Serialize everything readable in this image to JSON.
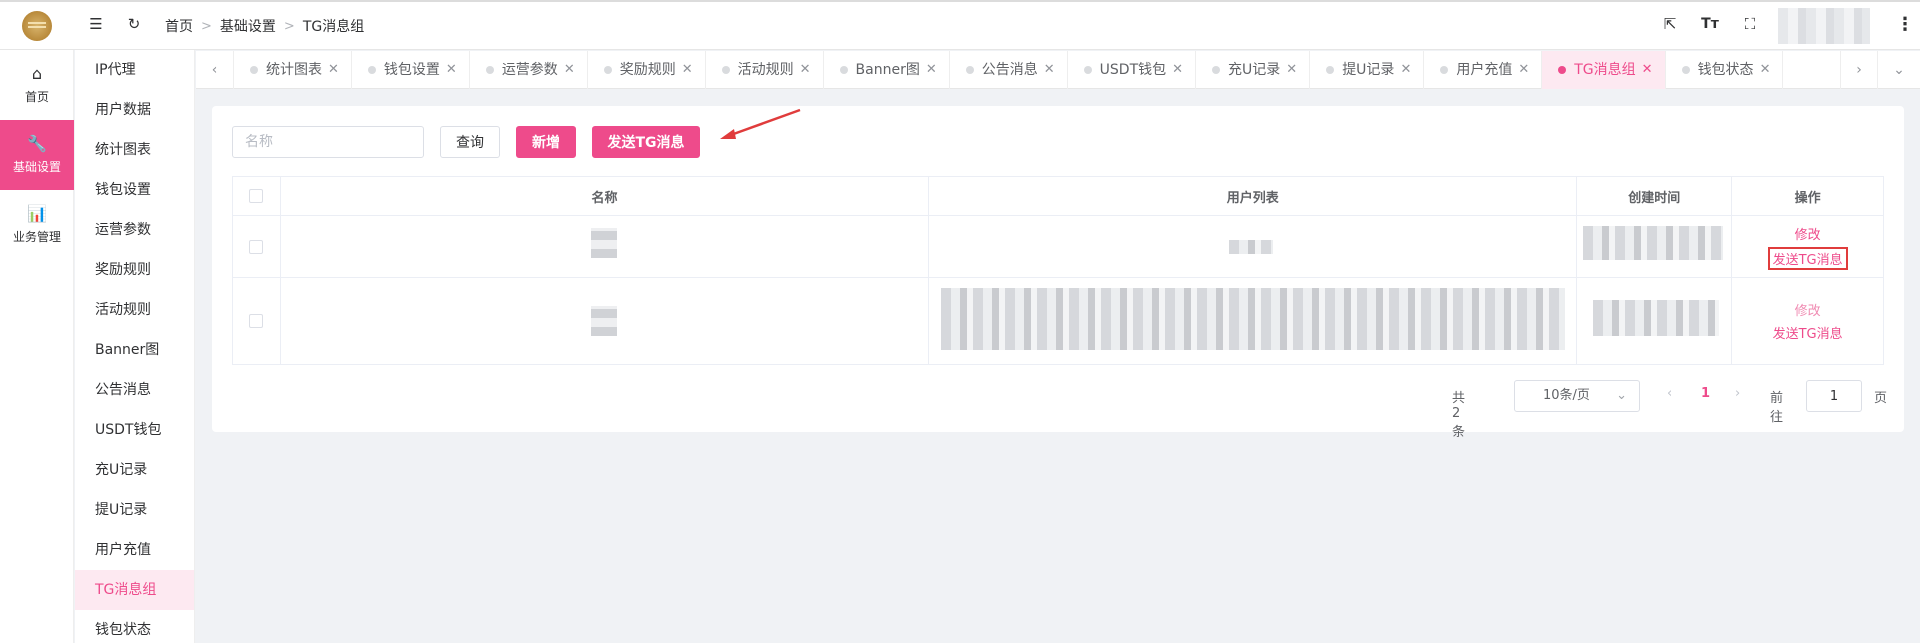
{
  "breadcrumb": [
    "首页",
    "基础设置",
    "TG消息组"
  ],
  "icon_rail": [
    {
      "label": "首页",
      "icon": "home-icon"
    },
    {
      "label": "基础设置",
      "icon": "wrench-icon",
      "active": true
    },
    {
      "label": "业务管理",
      "icon": "bar-chart-icon"
    }
  ],
  "submenu": [
    "IP代理",
    "用户数据",
    "统计图表",
    "钱包设置",
    "运营参数",
    "奖励规则",
    "活动规则",
    "Banner图",
    "公告消息",
    "USDT钱包",
    "充U记录",
    "提U记录",
    "用户充值",
    "TG消息组",
    "钱包状态"
  ],
  "submenu_active": "TG消息组",
  "tabs": [
    "统计图表",
    "钱包设置",
    "运营参数",
    "奖励规则",
    "活动规则",
    "Banner图",
    "公告消息",
    "USDT钱包",
    "充U记录",
    "提U记录",
    "用户充值",
    "TG消息组",
    "钱包状态"
  ],
  "tab_active": "TG消息组",
  "toolbar": {
    "search_placeholder": "名称",
    "query_label": "查询",
    "add_label": "新增",
    "send_label": "发送TG消息"
  },
  "table": {
    "headers": [
      "名称",
      "用户列表",
      "创建时间",
      "操作"
    ],
    "row_actions": {
      "edit": "修改",
      "send": "发送TG消息"
    }
  },
  "pagination": {
    "total_text": "共 2 条",
    "page_size": "10条/页",
    "current_page": "1",
    "goto_label": "前往",
    "goto_value": "1",
    "page_suffix": "页"
  },
  "colors": {
    "accent": "#ee4b8b",
    "annotation": "#e03c3c"
  }
}
